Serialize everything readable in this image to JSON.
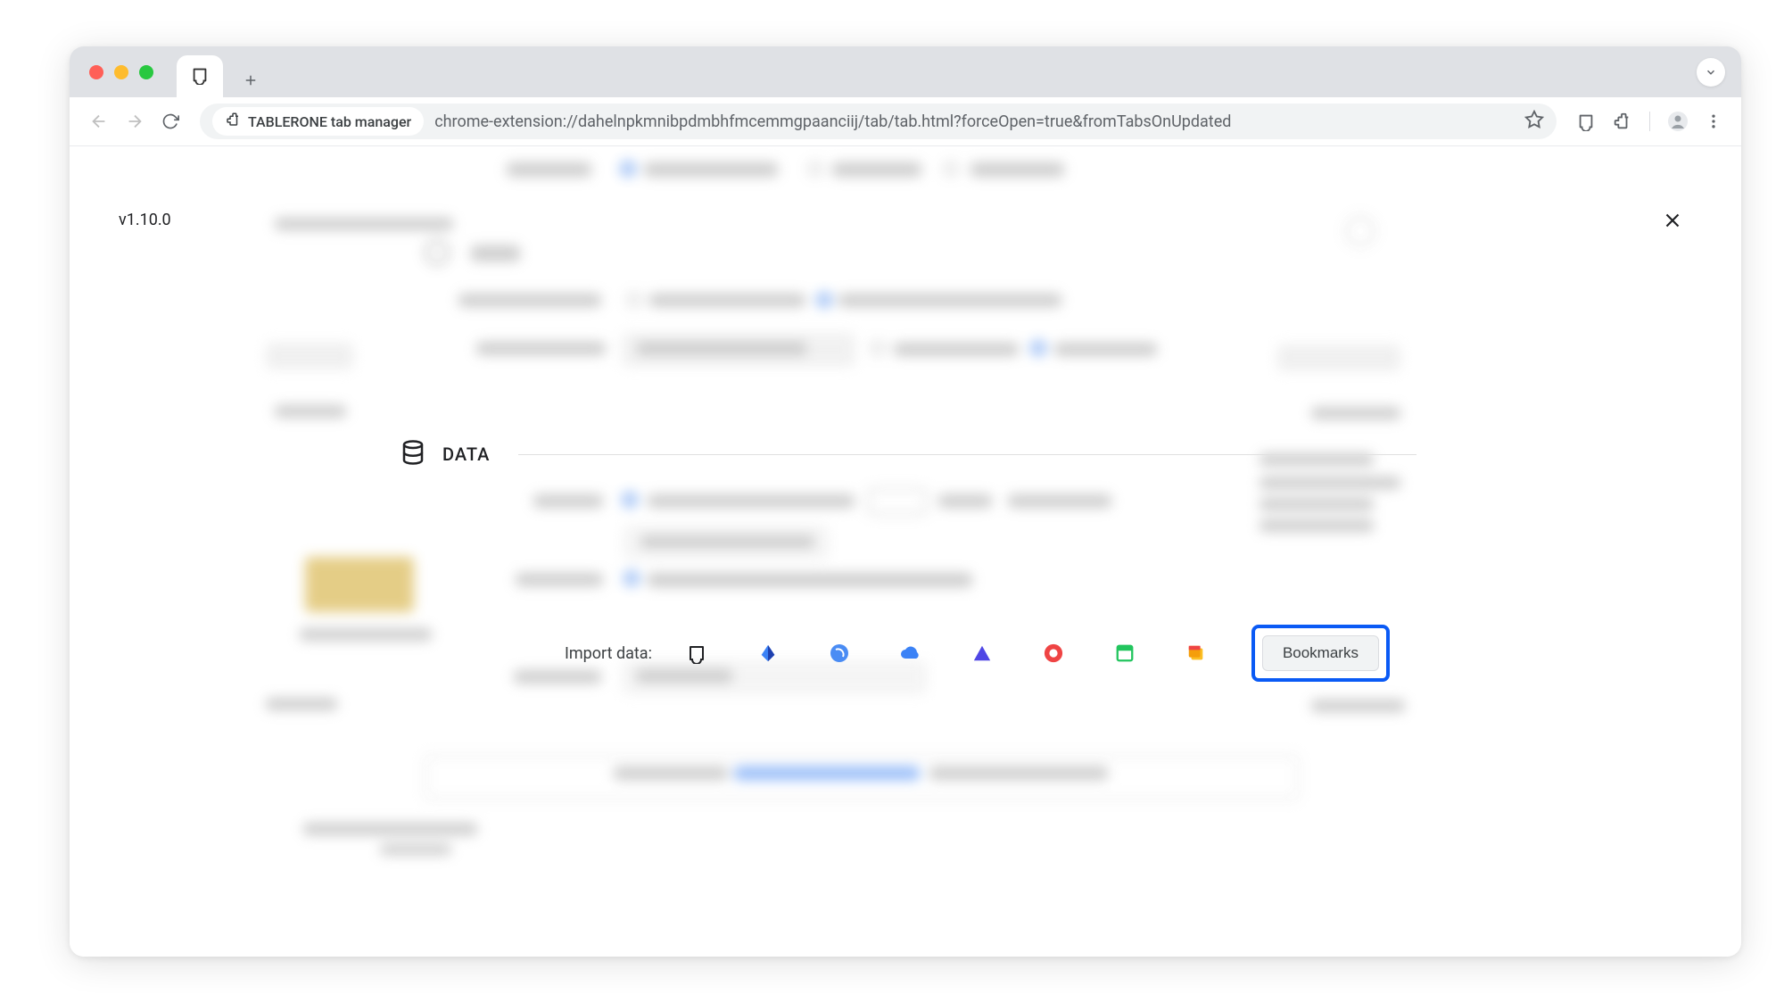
{
  "browser": {
    "tab_title": "TABLERONE tab manager",
    "url": "chrome-extension://dahelnpkmnibpdmbhfmcemmgpaanciij/tab/tab.html?forceOpen=true&fromTabsOnUpdated"
  },
  "app": {
    "version": "v1.10.0",
    "data_section_title": "DATA",
    "import_label": "Import data:",
    "bookmarks_button": "Bookmarks"
  }
}
